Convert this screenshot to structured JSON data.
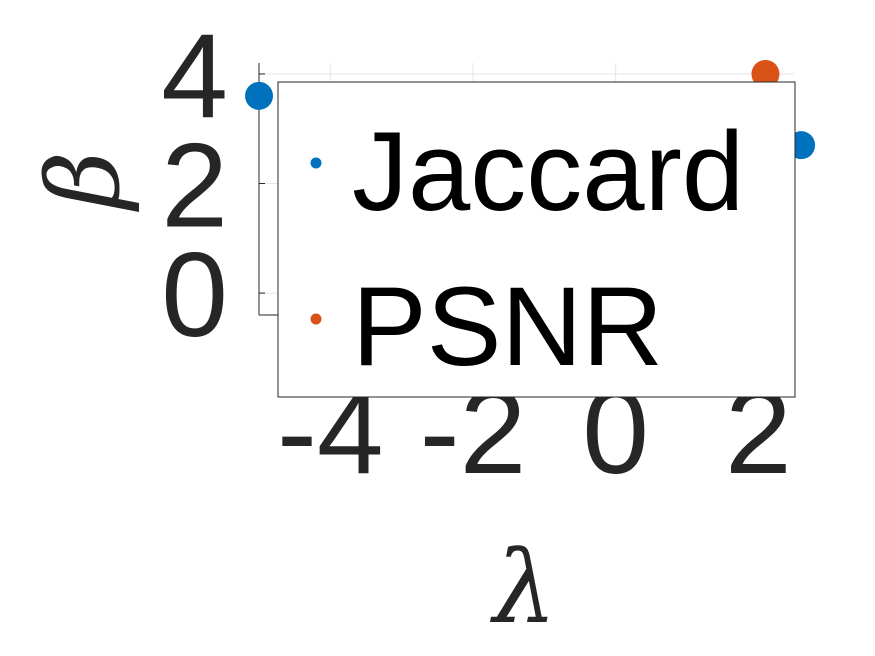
{
  "chart_data": {
    "type": "scatter",
    "title": "",
    "xlabel": "λ",
    "ylabel": "β",
    "xlim": [
      -5,
      2.5
    ],
    "ylim": [
      -0.4,
      4.2
    ],
    "xticks": [
      -4,
      -2,
      0,
      2
    ],
    "yticks": [
      0,
      2,
      4
    ],
    "xtick_labels": [
      "-4",
      "-2",
      "0",
      "2"
    ],
    "ytick_labels": [
      "0",
      "2",
      "4"
    ],
    "grid": true,
    "legend_placement": "inside, top-right",
    "series": [
      {
        "name": "Jaccard",
        "color": "#0072BD",
        "points": [
          {
            "x": -5,
            "y": 3.6
          },
          {
            "x": 2.6,
            "y": 2.7
          }
        ]
      },
      {
        "name": "PSNR",
        "color": "#D95319",
        "points": [
          {
            "x": 2.1,
            "y": 4.0
          }
        ]
      }
    ]
  }
}
